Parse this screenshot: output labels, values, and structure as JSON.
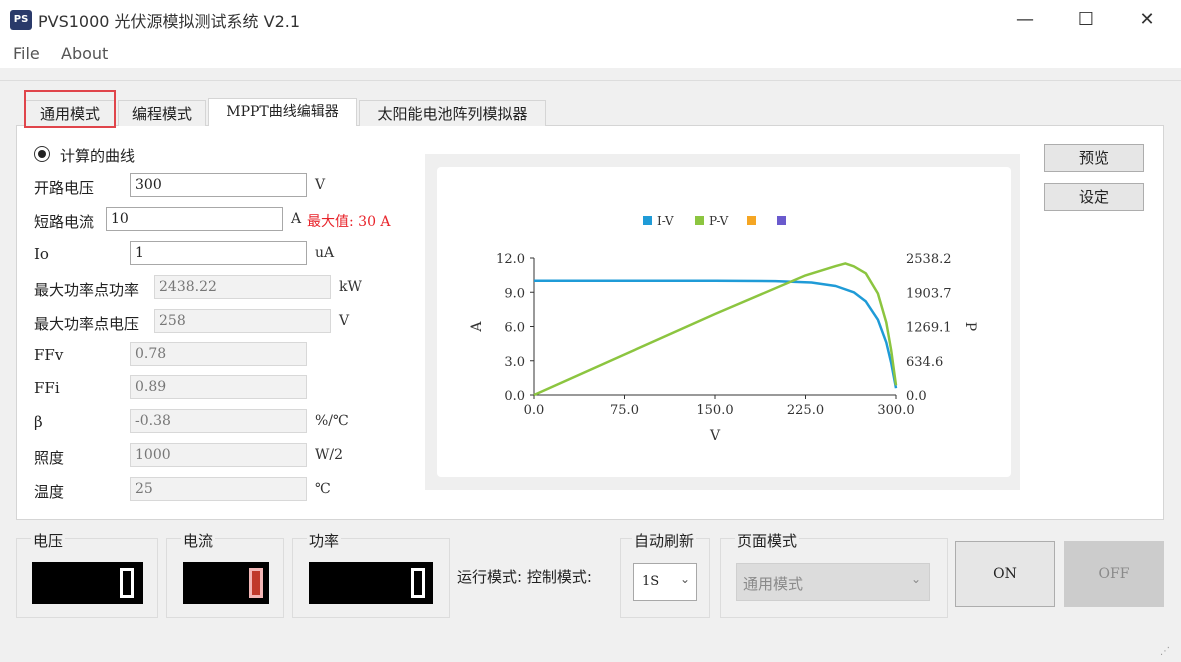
{
  "window": {
    "icon_text": "PS",
    "title": "PVS1000 光伏源模拟测试系统 V2.1",
    "minimize": "—",
    "maximize": "☐",
    "close": "✕"
  },
  "menu": [
    "File",
    "About"
  ],
  "tabs": [
    {
      "label": "通用模式"
    },
    {
      "label": "编程模式"
    },
    {
      "label": "MPPT曲线编辑器"
    },
    {
      "label": "太阳能电池阵列模拟器"
    }
  ],
  "form": {
    "radio_label": "计算的曲线",
    "voc": {
      "label": "开路电压",
      "value": "300",
      "unit": "V"
    },
    "isc": {
      "label": "短路电流",
      "value": "10",
      "unit": "A",
      "max_note": "最大值: 30 A"
    },
    "io": {
      "label": "Io",
      "value": "1",
      "unit": "uA"
    },
    "pmax": {
      "label": "最大功率点功率",
      "value": "2438.22",
      "unit": "kW"
    },
    "vmp": {
      "label": "最大功率点电压",
      "value": "258",
      "unit": "V"
    },
    "ffv": {
      "label": "FFv",
      "value": "0.78"
    },
    "ffi": {
      "label": "FFi",
      "value": "0.89"
    },
    "beta": {
      "label": "β",
      "value": "-0.38",
      "unit": "%/℃"
    },
    "irradiance": {
      "label": "照度",
      "value": "1000",
      "unit": "W/2"
    },
    "temperature": {
      "label": "温度",
      "value": "25",
      "unit": "℃"
    }
  },
  "side_buttons": {
    "preview": "预览",
    "set": "设定"
  },
  "chart_data": {
    "type": "line",
    "legend": [
      "I-V",
      "P-V",
      "",
      ""
    ],
    "legend_colors": [
      "#1f9bd7",
      "#8cc540",
      "#f5a623",
      "#6a5acd"
    ],
    "xlabel": "V",
    "ylabel_left": "A",
    "ylabel_right": "P",
    "x_ticks": [
      "0.0",
      "75.0",
      "150.0",
      "225.0",
      "300.0"
    ],
    "y_left_ticks": [
      "0.0",
      "3.0",
      "6.0",
      "9.0",
      "12.0"
    ],
    "y_right_ticks": [
      "0.0",
      "634.6",
      "1269.1",
      "1903.7",
      "2538.2"
    ],
    "xlim": [
      0,
      300
    ],
    "ylim_left": [
      0,
      12
    ],
    "ylim_right": [
      0,
      2538.2
    ],
    "series": [
      {
        "name": "I-V",
        "axis": "left",
        "color": "#1f9bd7",
        "x": [
          0,
          150,
          200,
          230,
          250,
          265,
          275,
          285,
          292,
          296,
          300
        ],
        "y": [
          10,
          10,
          9.98,
          9.85,
          9.55,
          9.0,
          8.2,
          6.6,
          4.6,
          2.8,
          0.6
        ]
      },
      {
        "name": "P-V",
        "axis": "left",
        "color": "#8cc540",
        "x": [
          0,
          75,
          150,
          225,
          250,
          258,
          265,
          275,
          285,
          292,
          296,
          300
        ],
        "y": [
          0,
          750,
          1500,
          2216,
          2388,
          2438,
          2385,
          2255,
          1881,
          1343,
          829,
          180
        ]
      }
    ]
  },
  "bottom": {
    "voltage": {
      "label": "电压",
      "digit": "0"
    },
    "current": {
      "label": "电流",
      "digit": "0"
    },
    "power": {
      "label": "功率",
      "digit": "0"
    },
    "run_mode_text": "运行模式: 控制模式:",
    "auto_refresh": {
      "label": "自动刷新",
      "value": "1S"
    },
    "page_mode": {
      "label": "页面模式",
      "value": "通用模式"
    },
    "on_button": "ON",
    "off_button": "OFF"
  }
}
